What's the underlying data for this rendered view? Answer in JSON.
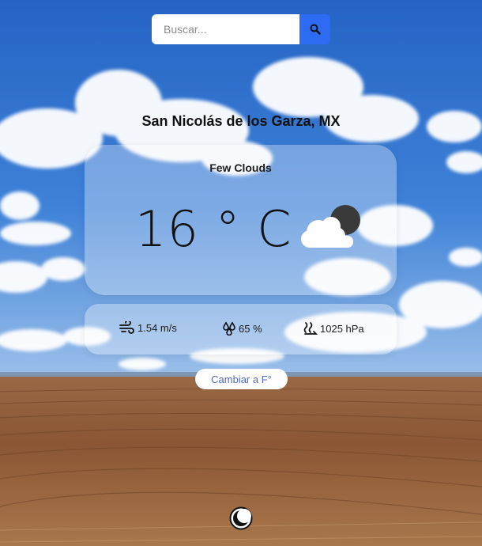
{
  "search": {
    "placeholder": "Buscar...",
    "button_icon": "search-icon"
  },
  "location": {
    "name": "San Nicolás de los Garza, MX"
  },
  "weather": {
    "description": "Few Clouds",
    "temperature": "16 ° C",
    "icon": "few-clouds-night-icon"
  },
  "stats": {
    "wind": "1.54 m/s",
    "humidity": "65 %",
    "pressure": "1025 hPa"
  },
  "unit_toggle": {
    "label": "Cambiar a F°"
  },
  "theme_toggle": {
    "icon": "contrast-icon"
  },
  "colors": {
    "sky_top": "#2f6fce",
    "sky_bottom": "#8fb7ea",
    "field": "#8a5a38",
    "accent": "#2d6cf2",
    "unit_text": "#4f6db8"
  }
}
